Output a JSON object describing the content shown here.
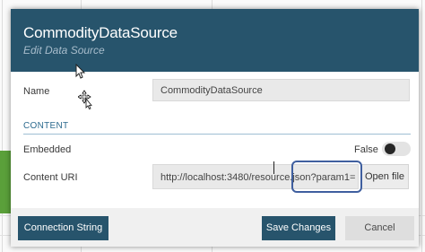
{
  "dialog": {
    "title": "CommodityDataSource",
    "subtitle": "Edit Data Source"
  },
  "fields": {
    "name_label": "Name",
    "name_value": "CommodityDataSource",
    "section_title": "CONTENT",
    "embedded_label": "Embedded",
    "embedded_state": "False",
    "content_uri_label": "Content URI",
    "content_uri_value": "http://localhost:3480/resource.json?param1= ????",
    "open_file_label": "Open file"
  },
  "footer": {
    "connection_string_label": "Connection String",
    "save_label": "Save Changes",
    "cancel_label": "Cancel"
  },
  "colors": {
    "header": "#27546c",
    "primary_button": "#27546c",
    "highlight_box": "#3f5f9f"
  }
}
